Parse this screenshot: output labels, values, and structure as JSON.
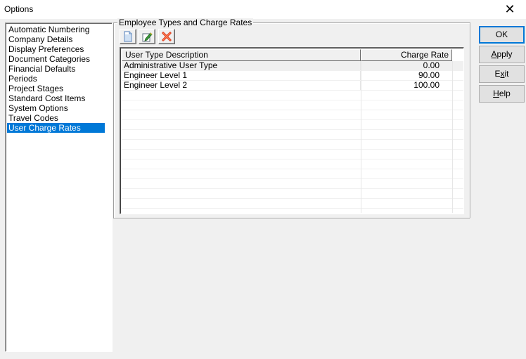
{
  "window": {
    "title": "Options",
    "close_glyph": "✕"
  },
  "nav": {
    "items": [
      "Automatic Numbering",
      "Company Details",
      "Display Preferences",
      "Document Categories",
      "Financial Defaults",
      "Periods",
      "Project Stages",
      "Standard Cost Items",
      "System Options",
      "Travel Codes",
      "User Charge Rates"
    ],
    "selected": "User Charge Rates"
  },
  "group": {
    "title": "Employee Types and Charge Rates",
    "toolbar": {
      "new_icon": "new-document-icon",
      "edit_icon": "edit-document-icon",
      "delete_icon": "delete-x-icon"
    },
    "table": {
      "columns": [
        "User Type Description",
        "Charge Rate"
      ],
      "rows": [
        [
          "Administrative User Type",
          "0.00"
        ],
        [
          "Engineer Level 1",
          "90.00"
        ],
        [
          "Engineer Level 2",
          "100.00"
        ]
      ]
    }
  },
  "buttons": {
    "ok": {
      "pre": "",
      "key": "",
      "post": "OK"
    },
    "apply": {
      "pre": "",
      "key": "A",
      "post": "pply"
    },
    "exit": {
      "pre": "E",
      "key": "x",
      "post": "it"
    },
    "help": {
      "pre": "",
      "key": "H",
      "post": "elp"
    }
  },
  "colors": {
    "selection": "#0078d7",
    "default_button_border": "#0078d7",
    "delete_icon": "#e04020"
  }
}
